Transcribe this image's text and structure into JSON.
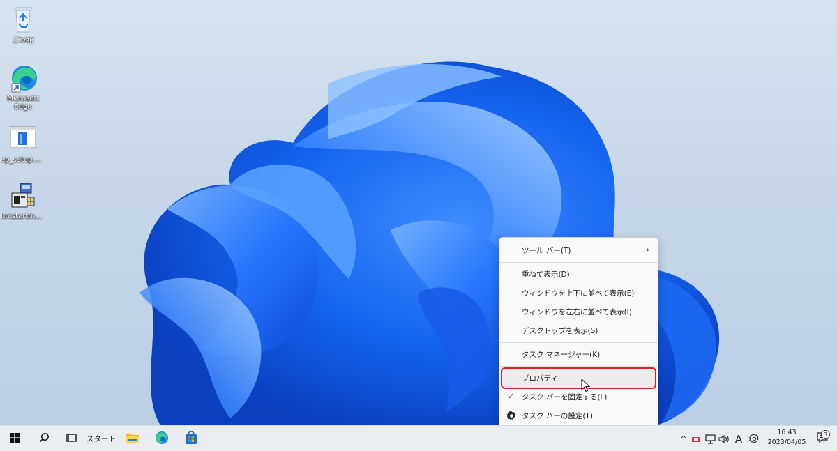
{
  "desktop": {
    "icons": [
      {
        "label": "ごみ箱"
      },
      {
        "label": "Microsoft Edge"
      },
      {
        "label": "ep_setup.exe"
      },
      {
        "label": "hmstartmen..."
      }
    ]
  },
  "context_menu": {
    "items": [
      {
        "label": "ツール バー(T)"
      },
      {
        "label": "重ねて表示(D)"
      },
      {
        "label": "ウィンドウを上下に並べて表示(E)"
      },
      {
        "label": "ウィンドウを左右に並べて表示(I)"
      },
      {
        "label": "デスクトップを表示(S)"
      },
      {
        "label": "タスク マネージャー(K)"
      },
      {
        "label": "プロパティ"
      },
      {
        "label": "タスク バーを固定する(L)"
      },
      {
        "label": "タスク バーの設定(T)"
      }
    ],
    "highlight_color": "#e12026"
  },
  "taskbar": {
    "start_label": "スタート",
    "ime_label": "A",
    "clock_time": "16:43",
    "clock_date": "2023/04/05",
    "notification_count": "3"
  },
  "colors": {
    "accent": "#0a63ff",
    "wallpaper_bg": "#c6d6e8"
  }
}
